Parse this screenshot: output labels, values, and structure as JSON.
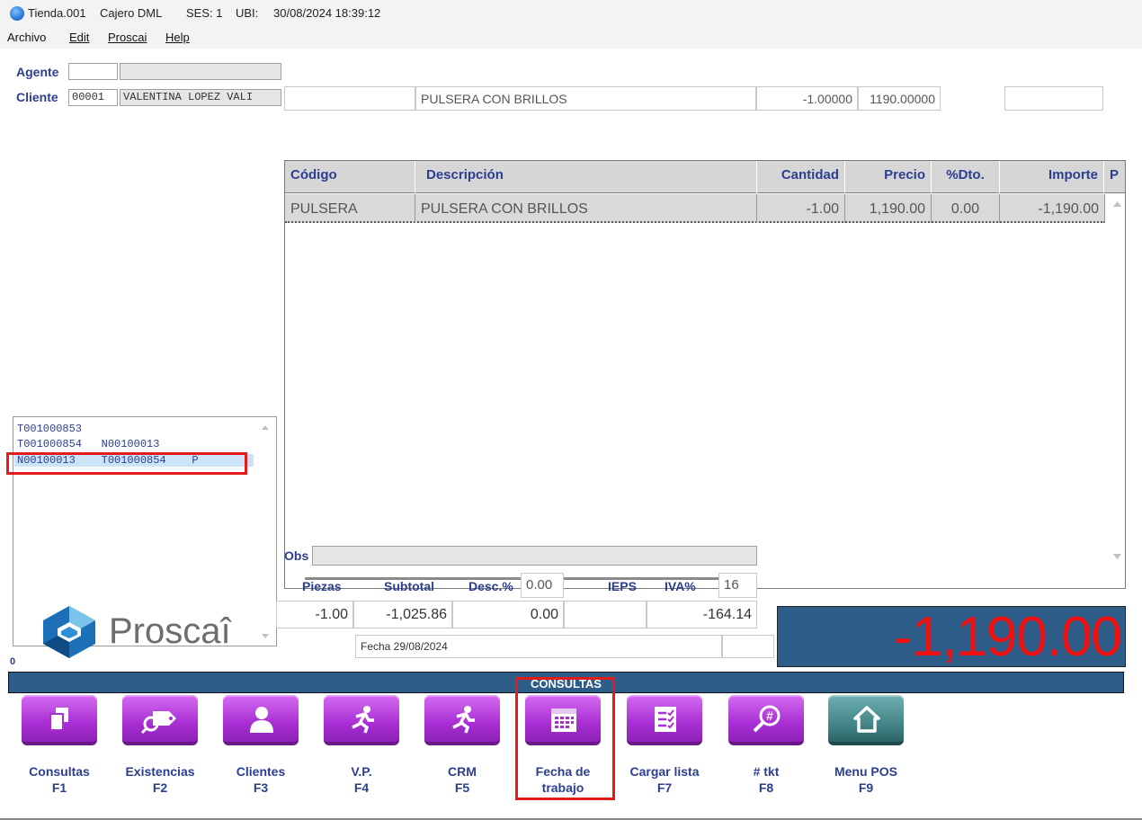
{
  "window": {
    "store": "Tienda.001",
    "cashier": "Cajero DML",
    "session": "SES: 1",
    "location": "UBI:",
    "datetime": "30/08/2024 18:39:12"
  },
  "menu": {
    "archivo": "Archivo",
    "edit": "Edit",
    "proscai": "Proscai",
    "help": "Help"
  },
  "header": {
    "agente_label": "Agente",
    "agente_code": "",
    "agente_name": "",
    "cliente_label": "Cliente",
    "cliente_code": "00001",
    "cliente_name": "VALENTINA LOPEZ VALI"
  },
  "entry": {
    "code": "",
    "description": "PULSERA CON BRILLOS",
    "quantity": "-1.00000",
    "price": "1190.00000",
    "extra": ""
  },
  "table": {
    "headers": [
      "Código",
      "Descripción",
      "Cantidad",
      "Precio",
      "%Dto.",
      "Importe",
      "P"
    ],
    "rows": [
      {
        "codigo": "PULSERA",
        "descripcion": "PULSERA CON BRILLOS",
        "cantidad": "-1.00",
        "precio": "1,190.00",
        "dto": "0.00",
        "importe": "-1,190.00"
      }
    ]
  },
  "tickets": [
    "T001000853",
    "T001000854   N00100013",
    "N00100013    T001000854    P"
  ],
  "obs": {
    "label": "Obs",
    "value": ""
  },
  "totals": {
    "piezas_label": "Piezas",
    "subtotal_label": "Subtotal",
    "desc_label": "Desc.%",
    "desc_pct": "0.00",
    "ieps_label": "IEPS",
    "iva_label": "IVA%",
    "iva_pct": "16",
    "piezas": "-1.00",
    "subtotal": "-1,025.86",
    "descuento": "0.00",
    "ieps": "",
    "iva": "-164.14",
    "fecha": "Fecha 29/08/2024",
    "grand_total": "-1,190.00"
  },
  "brand": {
    "name": "Proscaî"
  },
  "counter": "0",
  "section_title": "CONSULTAS",
  "buttons": [
    {
      "name": "Consultas",
      "key": "F1",
      "icon": "copy-icon"
    },
    {
      "name": "Existencias",
      "key": "F2",
      "icon": "tag-search-icon"
    },
    {
      "name": "Clientes",
      "key": "F3",
      "icon": "person-icon"
    },
    {
      "name": "V.P.",
      "key": "F4",
      "icon": "running-person-icon"
    },
    {
      "name": "CRM",
      "key": "F5",
      "icon": "running-person-icon"
    },
    {
      "name": "Fecha de",
      "name2": "trabajo",
      "icon": "calendar-icon"
    },
    {
      "name": "Cargar lista",
      "key": "F7",
      "icon": "checklist-icon"
    },
    {
      "name": "# tkt",
      "key": "F8",
      "icon": "hash-search-icon"
    },
    {
      "name": "Menu POS",
      "key": "F9",
      "icon": "home-icon"
    }
  ],
  "colors": {
    "accent_blue": "#2f5d8a",
    "label_blue": "#2c3e91",
    "button_purple": "#a92fd4",
    "button_teal": "#3e7f82",
    "total_red": "#f01010",
    "highlight_red": "#e21b1b"
  }
}
